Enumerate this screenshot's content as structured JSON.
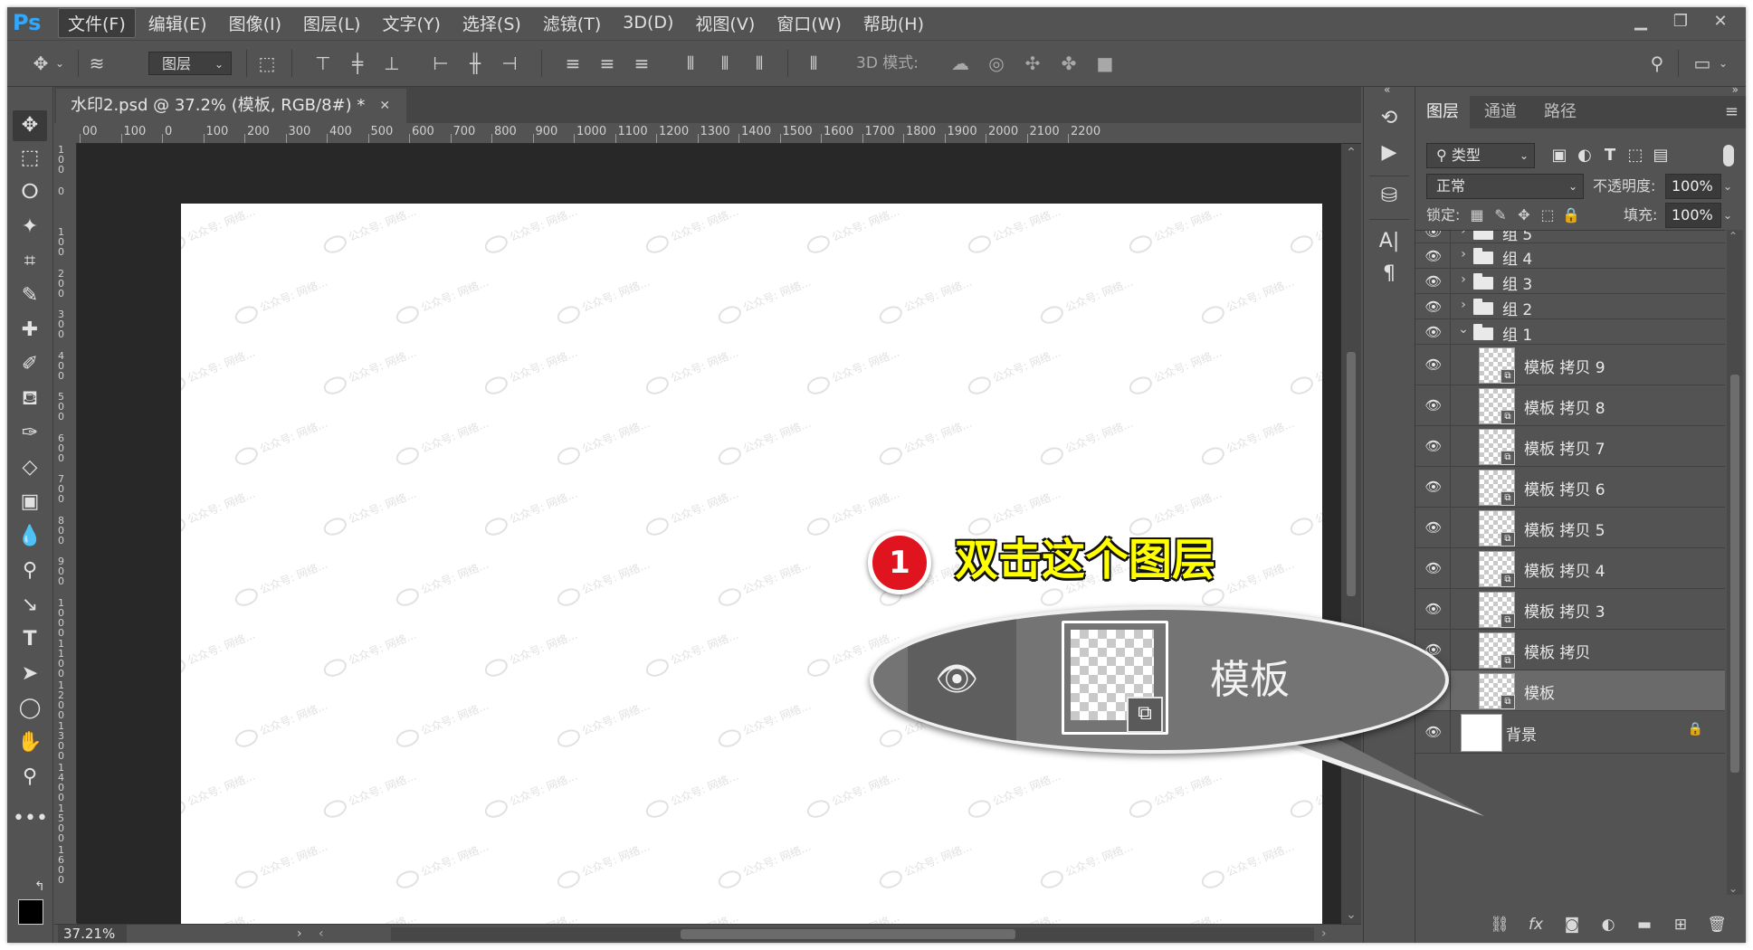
{
  "app": {
    "logo": "Ps"
  },
  "menubar": {
    "items": [
      "文件(F)",
      "编辑(E)",
      "图像(I)",
      "图层(L)",
      "文字(Y)",
      "选择(S)",
      "滤镜(T)",
      "3D(D)",
      "视图(V)",
      "窗口(W)",
      "帮助(H)"
    ],
    "window_controls": [
      "minimize",
      "restore",
      "close"
    ]
  },
  "options_bar": {
    "tool_icon": "move-icon",
    "auto_select_target": "图层",
    "mode_label": "3D 模式:"
  },
  "tools": [
    "move-icon",
    "marquee-icon",
    "lasso-icon",
    "magic-wand-icon",
    "crop-icon",
    "eyedropper-icon",
    "healing-brush-icon",
    "brush-icon",
    "clone-stamp-icon",
    "history-brush-icon",
    "eraser-icon",
    "gradient-icon",
    "blur-icon",
    "dodge-icon",
    "pen-icon",
    "type-icon",
    "path-select-icon",
    "ellipse-icon",
    "hand-icon",
    "zoom-icon",
    "more-tools-icon"
  ],
  "document": {
    "tab_title": "水印2.psd @ 37.2% (模板, RGB/8#) *",
    "zoom": "37.21%",
    "ruler_top": [
      "00",
      "100",
      "0",
      "100",
      "200",
      "300",
      "400",
      "500",
      "600",
      "700",
      "800",
      "900",
      "1000",
      "1100",
      "1200",
      "1300",
      "1400",
      "1500",
      "1600",
      "1700",
      "1800",
      "1900",
      "2000",
      "2100",
      "2200"
    ],
    "ruler_left": [
      "100",
      "0",
      "100",
      "200",
      "300",
      "400",
      "500",
      "600",
      "700",
      "800",
      "900",
      "1000",
      "1100",
      "1200",
      "1300",
      "1400",
      "1500",
      "1600"
    ],
    "watermark_text": "公众号: 网络...",
    "colors": {
      "canvas_bg": "#282828",
      "artboard": "#ffffff",
      "ui_bg": "#535353"
    }
  },
  "panel": {
    "tabs": [
      "图层",
      "通道",
      "路径"
    ],
    "active_tab": "图层",
    "filter_kind": "类型",
    "blend_mode": "正常",
    "opacity_label": "不透明度:",
    "opacity_value": "100%",
    "lock_label": "锁定:",
    "fill_label": "填充:",
    "fill_value": "100%"
  },
  "layers": [
    {
      "name": "组 5",
      "type": "group",
      "expanded": false,
      "partial": true
    },
    {
      "name": "组 4",
      "type": "group",
      "expanded": false
    },
    {
      "name": "组 3",
      "type": "group",
      "expanded": false
    },
    {
      "name": "组 2",
      "type": "group",
      "expanded": false
    },
    {
      "name": "组 1",
      "type": "group",
      "expanded": true
    },
    {
      "name": "模板 拷贝 9",
      "type": "smart"
    },
    {
      "name": "模板 拷贝 8",
      "type": "smart"
    },
    {
      "name": "模板 拷贝 7",
      "type": "smart"
    },
    {
      "name": "模板 拷贝 6",
      "type": "smart"
    },
    {
      "name": "模板 拷贝 5",
      "type": "smart"
    },
    {
      "name": "模板 拷贝 4",
      "type": "smart"
    },
    {
      "name": "模板 拷贝 3",
      "type": "smart"
    },
    {
      "name": "模板 拷贝",
      "type": "smart"
    },
    {
      "name": "模板",
      "type": "smart",
      "selected": true
    },
    {
      "name": "背景",
      "type": "background",
      "locked": true
    }
  ],
  "callout": {
    "step_number": "1",
    "instruction": "双击这个图层",
    "zoomed_layer_name": "模板"
  }
}
